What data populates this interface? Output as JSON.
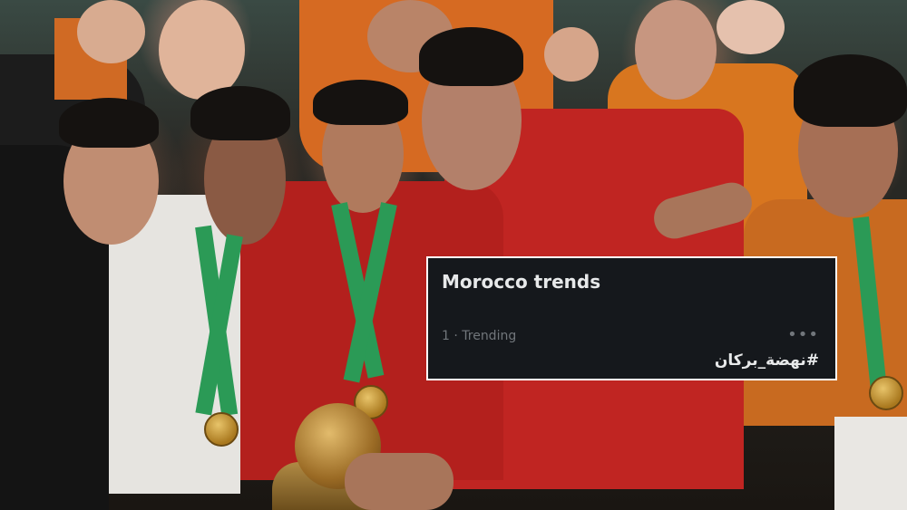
{
  "trends_card": {
    "title": "Morocco trends",
    "rank_label": "1 · Trending",
    "more_icon": "more-horizontal-icon",
    "hashtag": "#نهضة_بركان"
  },
  "colors": {
    "card_background": "#15181c",
    "card_border": "#ffffff",
    "title_text": "#e7e9ea",
    "meta_text": "#71767b"
  }
}
